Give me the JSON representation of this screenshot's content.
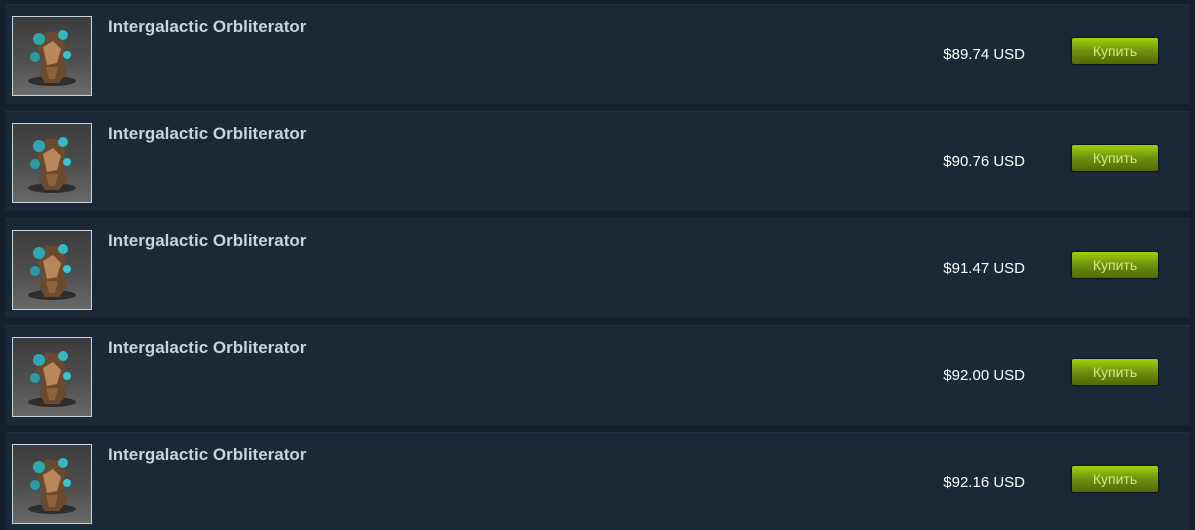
{
  "listings": [
    {
      "item_name": "Intergalactic Orbliterator",
      "price": "$89.74 USD",
      "buy_label": "Купить",
      "thumbnail_icon": "dota-item-thumbnail-icon"
    },
    {
      "item_name": "Intergalactic Orbliterator",
      "price": "$90.76 USD",
      "buy_label": "Купить",
      "thumbnail_icon": "dota-item-thumbnail-icon"
    },
    {
      "item_name": "Intergalactic Orbliterator",
      "price": "$91.47 USD",
      "buy_label": "Купить",
      "thumbnail_icon": "dota-item-thumbnail-icon"
    },
    {
      "item_name": "Intergalactic Orbliterator",
      "price": "$92.00 USD",
      "buy_label": "Купить",
      "thumbnail_icon": "dota-item-thumbnail-icon"
    },
    {
      "item_name": "Intergalactic Orbliterator",
      "price": "$92.16 USD",
      "buy_label": "Купить",
      "thumbnail_icon": "dota-item-thumbnail-icon"
    }
  ],
  "colors": {
    "page_background": "#1b2838",
    "item_name_text": "#c6d4df",
    "price_text": "#ffffff",
    "buy_button_green": "#6c8e10",
    "buy_button_text": "#d2e885"
  }
}
